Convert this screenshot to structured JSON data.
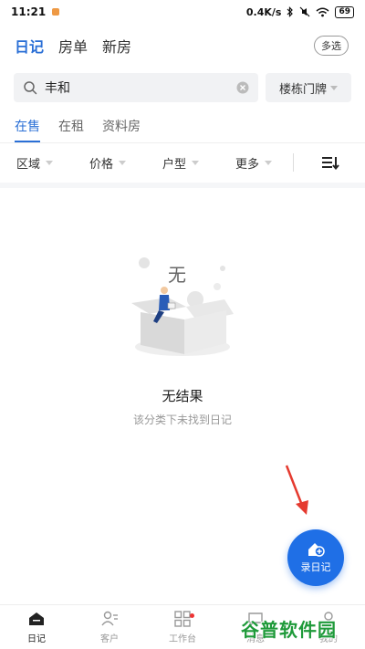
{
  "status_bar": {
    "time": "11:21",
    "network_speed": "0.4K/s",
    "battery": "69"
  },
  "top_tabs": [
    {
      "label": "日记",
      "active": true
    },
    {
      "label": "房单",
      "active": false
    },
    {
      "label": "新房",
      "active": false
    }
  ],
  "multi_select_label": "多选",
  "search": {
    "value": "丰和",
    "building_label": "楼栋门牌"
  },
  "sub_tabs": [
    {
      "label": "在售",
      "active": true
    },
    {
      "label": "在租",
      "active": false
    },
    {
      "label": "资料房",
      "active": false
    }
  ],
  "filters": {
    "area": "区域",
    "price": "价格",
    "layout": "户型",
    "more": "更多"
  },
  "empty_state": {
    "illustration_char": "无",
    "title": "无结果",
    "subtitle": "该分类下未找到日记"
  },
  "fab": {
    "label": "录日记"
  },
  "bottom_nav": [
    {
      "label": "日记",
      "icon": "diary-icon",
      "active": true
    },
    {
      "label": "客户",
      "icon": "customer-icon",
      "active": false
    },
    {
      "label": "工作台",
      "icon": "workbench-icon",
      "active": false,
      "badge": true
    },
    {
      "label": "消息",
      "icon": "message-icon",
      "active": false
    },
    {
      "label": "我的",
      "icon": "profile-icon",
      "active": false
    }
  ],
  "watermark": "谷普软件园",
  "colors": {
    "accent": "#2a6fd6",
    "fab": "#1f6fe6",
    "arrow": "#e53a2f",
    "watermark": "#1f9a3a"
  }
}
